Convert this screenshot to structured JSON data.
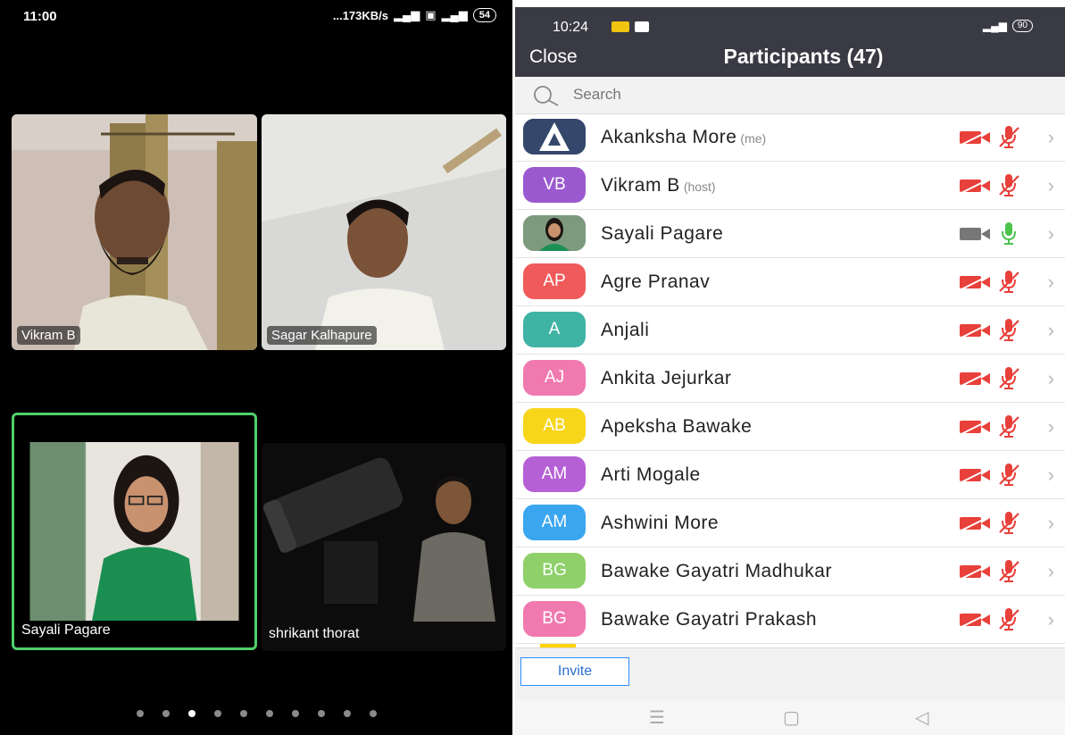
{
  "left_phone": {
    "status_bar": {
      "time": "11:00",
      "network": "...173KB/s",
      "battery": "54"
    },
    "tiles": [
      {
        "name": "Vikram B"
      },
      {
        "name": "Sagar Kalhapure"
      },
      {
        "name": "Sayali Pagare"
      },
      {
        "name": "shrikant thorat"
      }
    ],
    "page_dots": {
      "count": 10,
      "active_index": 2
    },
    "active_speaker_color": "#4fd06b"
  },
  "right_phone": {
    "status_bar": {
      "time": "10:24",
      "battery": "90"
    },
    "header": {
      "close_label": "Close",
      "title": "Participants (47)"
    },
    "search": {
      "placeholder": "Search"
    },
    "participants": [
      {
        "initials": "",
        "avatar": "logo",
        "name": "Akanksha More",
        "tag": "(me)",
        "video": "off",
        "audio": "muted"
      },
      {
        "initials": "VB",
        "color": "#9b59d0",
        "name": "Vikram B",
        "tag": "(host)",
        "video": "off",
        "audio": "muted"
      },
      {
        "initials": "",
        "avatar": "photo",
        "name": "Sayali Pagare",
        "tag": "",
        "video": "on",
        "audio": "on"
      },
      {
        "initials": "AP",
        "color": "#f05a5a",
        "name": "Agre Pranav",
        "tag": "",
        "video": "off",
        "audio": "muted"
      },
      {
        "initials": "A",
        "color": "#3fb3a5",
        "name": "Anjali",
        "tag": "",
        "video": "off",
        "audio": "muted"
      },
      {
        "initials": "AJ",
        "color": "#f07ab0",
        "name": "Ankita Jejurkar",
        "tag": "",
        "video": "off",
        "audio": "muted"
      },
      {
        "initials": "AB",
        "color": "#f7d51a",
        "name": "Apeksha Bawake",
        "tag": "",
        "video": "off",
        "audio": "muted"
      },
      {
        "initials": "AM",
        "color": "#b660d6",
        "name": "Arti Mogale",
        "tag": "",
        "video": "off",
        "audio": "muted"
      },
      {
        "initials": "AM",
        "color": "#3aa6f0",
        "name": "Ashwini More",
        "tag": "",
        "video": "off",
        "audio": "muted"
      },
      {
        "initials": "BG",
        "color": "#8fd06a",
        "name": "Bawake Gayatri Madhukar",
        "tag": "",
        "video": "off",
        "audio": "muted"
      },
      {
        "initials": "BG",
        "color": "#f07ab0",
        "name": "Bawake Gayatri Prakash",
        "tag": "",
        "video": "off",
        "audio": "muted"
      }
    ],
    "invite_label": "Invite",
    "colors": {
      "header_bg": "#3a3a44",
      "muted_red": "#e8403a",
      "mic_on_green": "#4cc34c",
      "invite_blue": "#2d8cff"
    }
  }
}
